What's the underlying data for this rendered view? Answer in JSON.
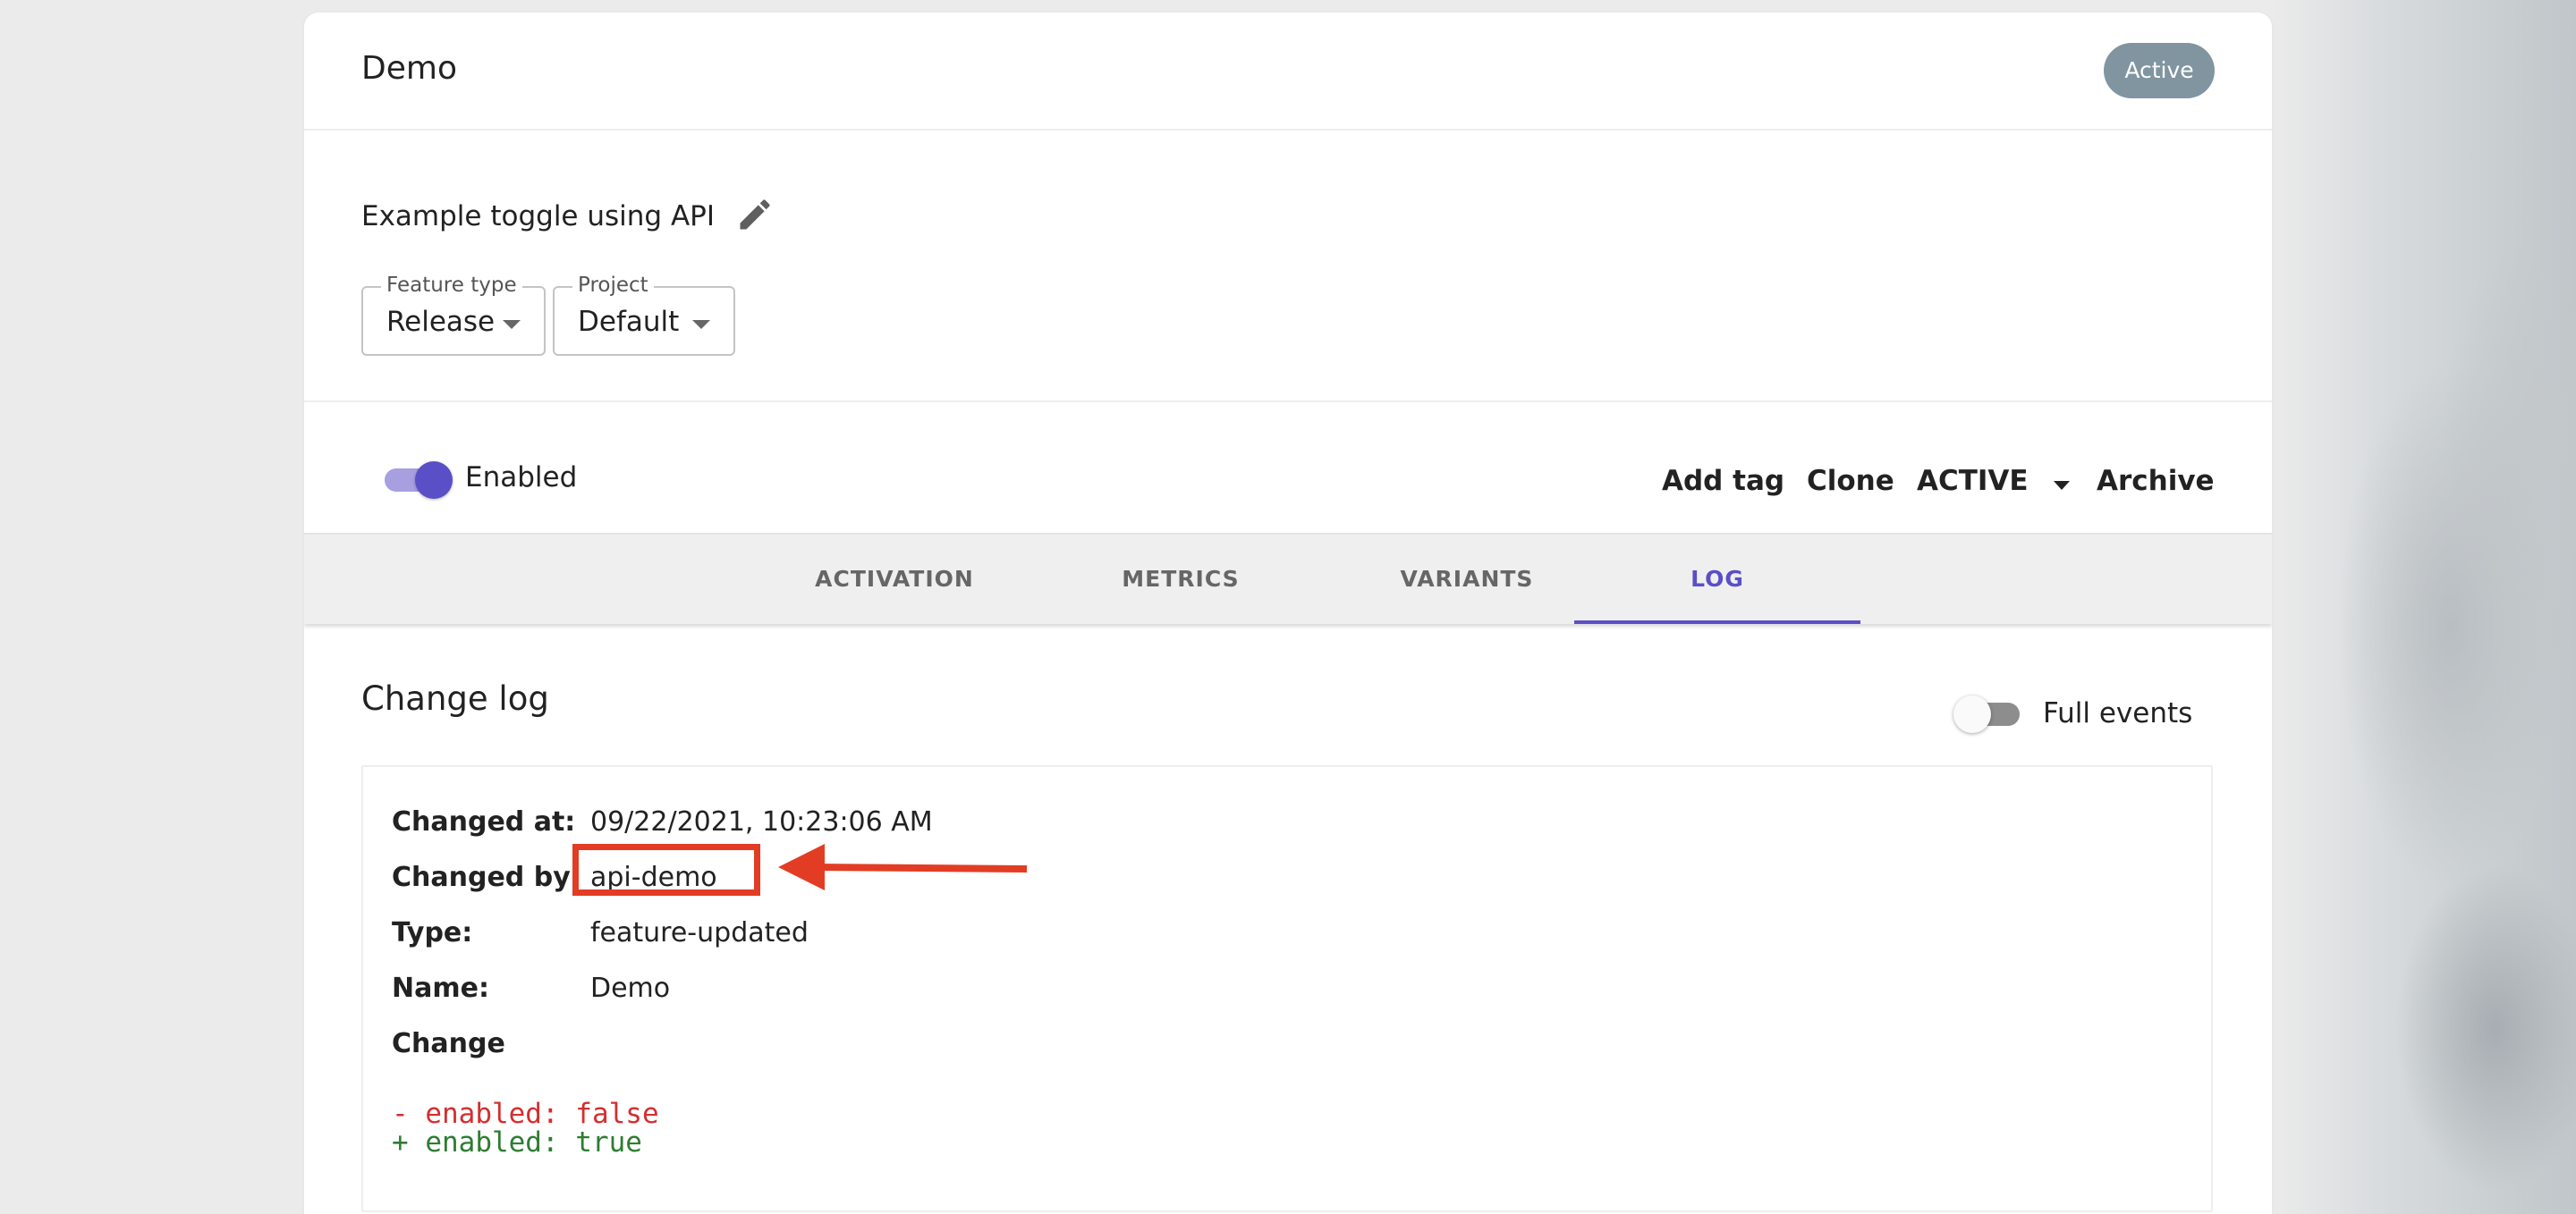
{
  "feature": {
    "name": "Demo",
    "status_badge": "Active",
    "description": "Example toggle using API"
  },
  "selects": {
    "feature_type": {
      "label": "Feature type",
      "value": "Release"
    },
    "project": {
      "label": "Project",
      "value": "Default"
    }
  },
  "toggle": {
    "label": "Enabled",
    "on": true
  },
  "actions": {
    "add_tag": "Add tag",
    "clone": "Clone",
    "state": "ACTIVE",
    "archive": "Archive"
  },
  "tabs": [
    {
      "label": "ACTIVATION",
      "active": false
    },
    {
      "label": "METRICS",
      "active": false
    },
    {
      "label": "VARIANTS",
      "active": false
    },
    {
      "label": "LOG",
      "active": true
    }
  ],
  "changelog": {
    "title": "Change log",
    "full_events_label": "Full events",
    "full_events_on": false,
    "entry": {
      "changed_at_label": "Changed at:",
      "changed_at": "09/22/2021, 10:23:06 AM",
      "changed_by_label": "Changed by:",
      "changed_by": "api-demo",
      "type_label": "Type:",
      "type": "feature-updated",
      "name_label": "Name:",
      "name": "Demo",
      "change_label": "Change",
      "diff_removed": "- enabled: false",
      "diff_added": "+ enabled: true"
    }
  },
  "colors": {
    "accent": "#5a4fc7",
    "badge": "#80959f",
    "annotation": "#e23d24",
    "diff_removed": "#d32f2f",
    "diff_added": "#2e7d32"
  }
}
